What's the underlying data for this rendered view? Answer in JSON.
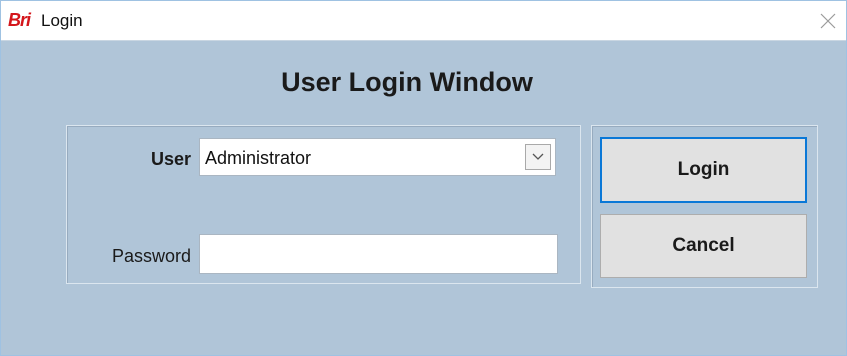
{
  "window": {
    "logo_text": "Bri",
    "title": "Login",
    "heading": "User Login Window"
  },
  "form": {
    "user_label": "User",
    "user_value": "Administrator",
    "password_label": "Password",
    "password_value": ""
  },
  "buttons": {
    "login_label": "Login",
    "cancel_label": "Cancel"
  },
  "icons": {
    "close": "close-icon",
    "dropdown": "chevron-down-icon"
  },
  "colors": {
    "logo": "#d4161b",
    "background": "#b0c5d8",
    "focus_border": "#0a78d7"
  }
}
